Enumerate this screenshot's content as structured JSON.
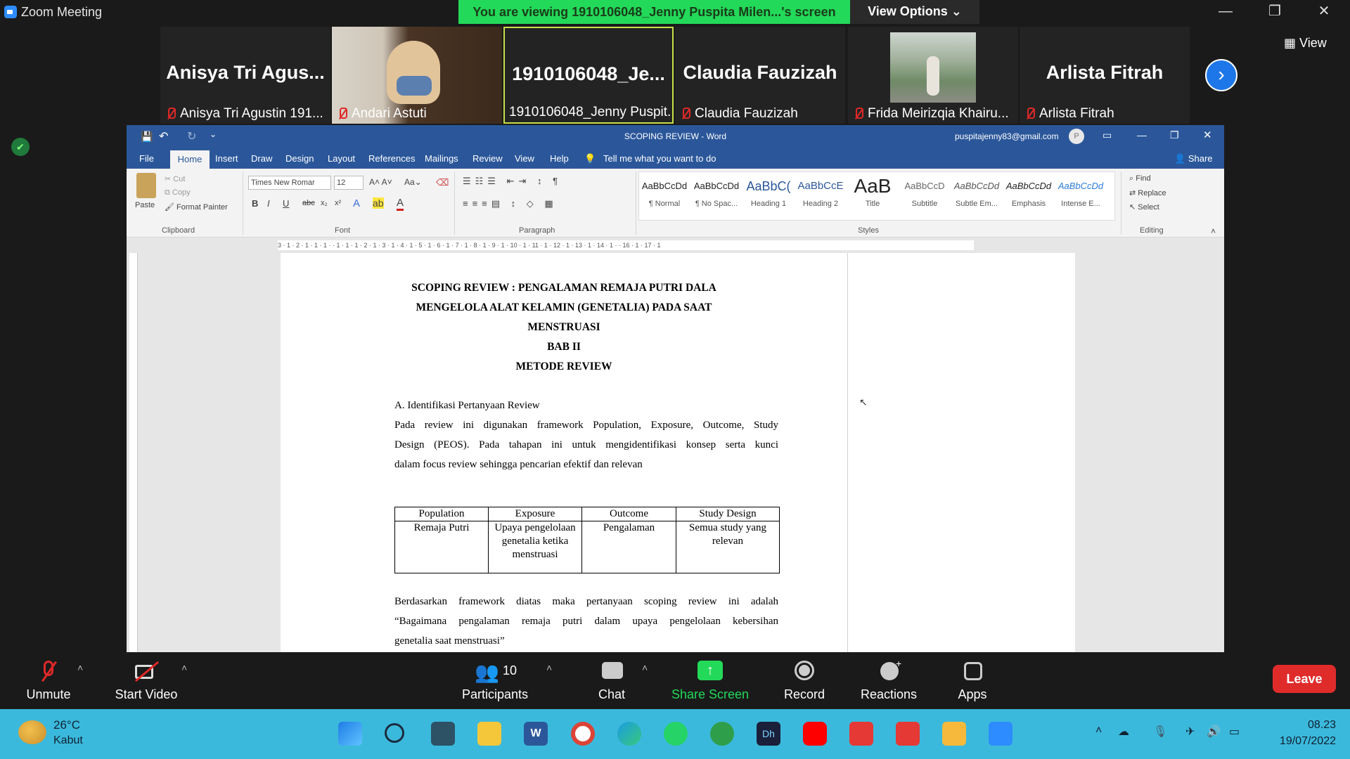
{
  "zoom": {
    "window_title": "Zoom Meeting",
    "share_banner": "You are viewing 1910106048_Jenny Puspita Milen...'s screen",
    "view_options": "View Options",
    "view_button": "View",
    "participants": [
      {
        "big": "Anisya Tri Agus...",
        "label": "Anisya Tri Agustin 191..."
      },
      {
        "big": "",
        "label": "Andari Astuti"
      },
      {
        "big": "1910106048_Je...",
        "label": "1910106048_Jenny Puspit..."
      },
      {
        "big": "Claudia Fauzizah",
        "label": "Claudia Fauzizah"
      },
      {
        "big": "",
        "label": "Frida Meirizqia Khairu..."
      },
      {
        "big": "Arlista Fitrah",
        "label": "Arlista Fitrah"
      }
    ],
    "toolbar": {
      "unmute": "Unmute",
      "start_video": "Start Video",
      "participants": "Participants",
      "participants_count": "10",
      "chat": "Chat",
      "share_screen": "Share Screen",
      "record": "Record",
      "reactions": "Reactions",
      "apps": "Apps",
      "leave": "Leave"
    },
    "colors": {
      "share_green": "#23d959",
      "leave_red": "#e02b2b",
      "accent_blue": "#2d8cff"
    }
  },
  "word": {
    "title": "SCOPING REVIEW  -  Word",
    "account": "puspitajenny83@gmail.com",
    "avatar": "P",
    "tabs": [
      "File",
      "Home",
      "Insert",
      "Draw",
      "Design",
      "Layout",
      "References",
      "Mailings",
      "Review",
      "View",
      "Help"
    ],
    "tell_me": "Tell me what you want to do",
    "share": "Share",
    "clipboard": {
      "paste": "Paste",
      "cut": "Cut",
      "copy": "Copy",
      "format_painter": "Format Painter",
      "label": "Clipboard"
    },
    "font": {
      "name": "Times New Romar",
      "size": "12",
      "label": "Font"
    },
    "paragraph_label": "Paragraph",
    "styles": [
      {
        "preview": "AaBbCcDd",
        "name": "¶ Normal"
      },
      {
        "preview": "AaBbCcDd",
        "name": "¶ No Spac..."
      },
      {
        "preview": "AaBbC(",
        "name": "Heading 1"
      },
      {
        "preview": "AaBbCcE",
        "name": "Heading 2"
      },
      {
        "preview": "AaB",
        "name": "Title"
      },
      {
        "preview": "AaBbCcD",
        "name": "Subtitle"
      },
      {
        "preview": "AaBbCcDd",
        "name": "Subtle Em..."
      },
      {
        "preview": "AaBbCcDd",
        "name": "Emphasis"
      },
      {
        "preview": "AaBbCcDd",
        "name": "Intense E..."
      }
    ],
    "styles_label": "Styles",
    "editing": {
      "find": "Find",
      "replace": "Replace",
      "select": "Select",
      "label": "Editing"
    },
    "ruler_text": "3 · 1 · 2 · 1 · 1 · 1 ·   · 1 · 1 · 1 · 2 · 1 · 3 · 1 · 4 · 1 · 5 · 1 · 6 · 1 · 7 · 1 · 8 · 1 · 9 · 1 · 10 · 1 · 11 · 1 · 12 · 1 · 13 · 1 · 14 · 1 ·   · 16 · 1 · 17 · 1",
    "colors": {
      "word_blue": "#2b579a"
    }
  },
  "document": {
    "title_lines": [
      "SCOPING REVIEW : PENGALAMAN REMAJA PUTRI DALA",
      "MENGELOLA ALAT KELAMIN (GENETALIA) PADA SAAT",
      "MENSTRUASI"
    ],
    "chapter": "BAB II",
    "chapter_title": "METODE REVIEW",
    "section_a": "A.  Identifikasi Pertanyaan Review",
    "para1_line1": "Pada review ini digunakan framework Population, Exposure, Outcome, Study",
    "para1_line2": "Design (PEOS). Pada tahapan ini untuk mengidentifikasi konsep serta kunci",
    "para1_line3": "dalam focus review sehingga pencarian efektif dan relevan",
    "table": {
      "headers": [
        "Population",
        "Exposure",
        "Outcome",
        "Study Design"
      ],
      "rows": [
        [
          "Remaja Putri",
          "Upaya pengelolaan genetalia ketika menstruasi",
          "Pengalaman",
          "Semua study yang relevan"
        ]
      ]
    },
    "para2_line1": "Berdasarkan framework diatas maka pertanyaan scoping review ini adalah",
    "para2_line2": "“Bagaimana pengalaman remaja putri dalam upaya pengelolaan kebersihan",
    "para2_line3": "genetalia saat menstruasi”"
  },
  "taskbar": {
    "temperature": "26°C",
    "weather": "Kabut",
    "time": "08.23",
    "date": "19/07/2022",
    "colors": {
      "taskbar_bg": "#3bb9dc"
    }
  }
}
